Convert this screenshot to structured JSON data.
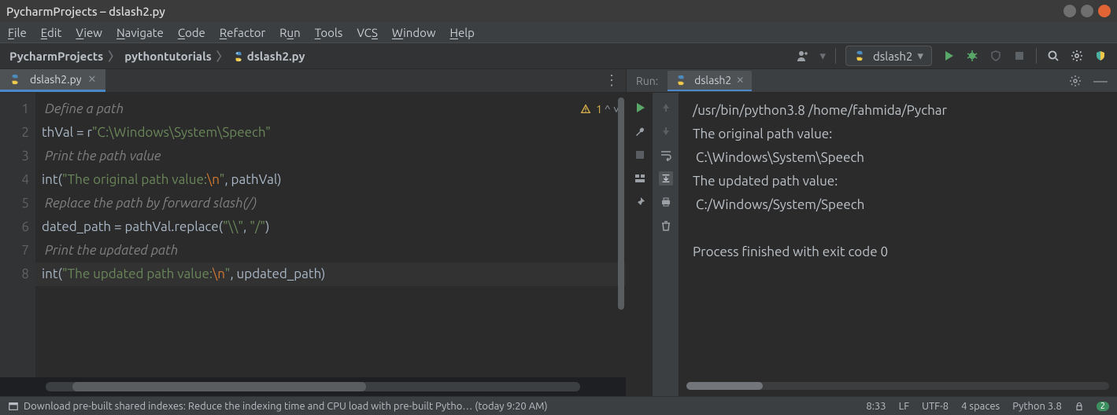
{
  "window": {
    "title": "PycharmProjects – dslash2.py"
  },
  "menu": {
    "file": "File",
    "edit": "Edit",
    "view": "View",
    "navigate": "Navigate",
    "code": "Code",
    "refactor": "Refactor",
    "run": "Run",
    "tools": "Tools",
    "vcs": "VCS",
    "window": "Window",
    "help": "Help"
  },
  "breadcrumbs": {
    "root": "PycharmProjects",
    "folder": "pythontutorials",
    "file": "dslash2.py"
  },
  "run_config": {
    "selected": "dslash2"
  },
  "tabs": {
    "active": "dslash2.py"
  },
  "inspections": {
    "warning_count": "1"
  },
  "code": {
    "line_numbers": [
      "1",
      "2",
      "3",
      "4",
      "5",
      "6",
      "7",
      "8"
    ],
    "l1": " Define a path",
    "l2a": "thVal = r",
    "l2b": "\"C:\\Windows\\System\\Speech\"",
    "l3": " Print the path value",
    "l4a": "int(",
    "l4b": "\"The original path value:",
    "l4c": "\\n",
    "l4d": "\"",
    "l4e": ", pathVal)",
    "l5": " Replace the path by forward slash(/)",
    "l6a": "dated_path = pathVal.replace(",
    "l6b": "\"\\\\\"",
    "l6c": ", ",
    "l6d": "\"/\"",
    "l6e": ")",
    "l7": " Print the updated path",
    "l8a": "int(",
    "l8b": "\"The updated path value:",
    "l8c": "\\n",
    "l8d": "\"",
    "l8e": ", updated_path)"
  },
  "run": {
    "label": "Run:",
    "tab": "dslash2",
    "out1": "/usr/bin/python3.8 /home/fahmida/Pychar",
    "out2": "The original path value:",
    "out3": " C:\\Windows\\System\\Speech",
    "out4": "The updated path value:",
    "out5": " C:/Windows/System/Speech",
    "out6": "",
    "out7": "Process finished with exit code 0"
  },
  "status": {
    "msg": "Download pre-built shared indexes: Reduce the indexing time and CPU load with pre-built Pytho… (today 9:20 AM)",
    "pos": "8:33",
    "le": "LF",
    "enc": "UTF-8",
    "indent": "4 spaces",
    "sdk": "Python 3.8",
    "notif_count": "2"
  }
}
